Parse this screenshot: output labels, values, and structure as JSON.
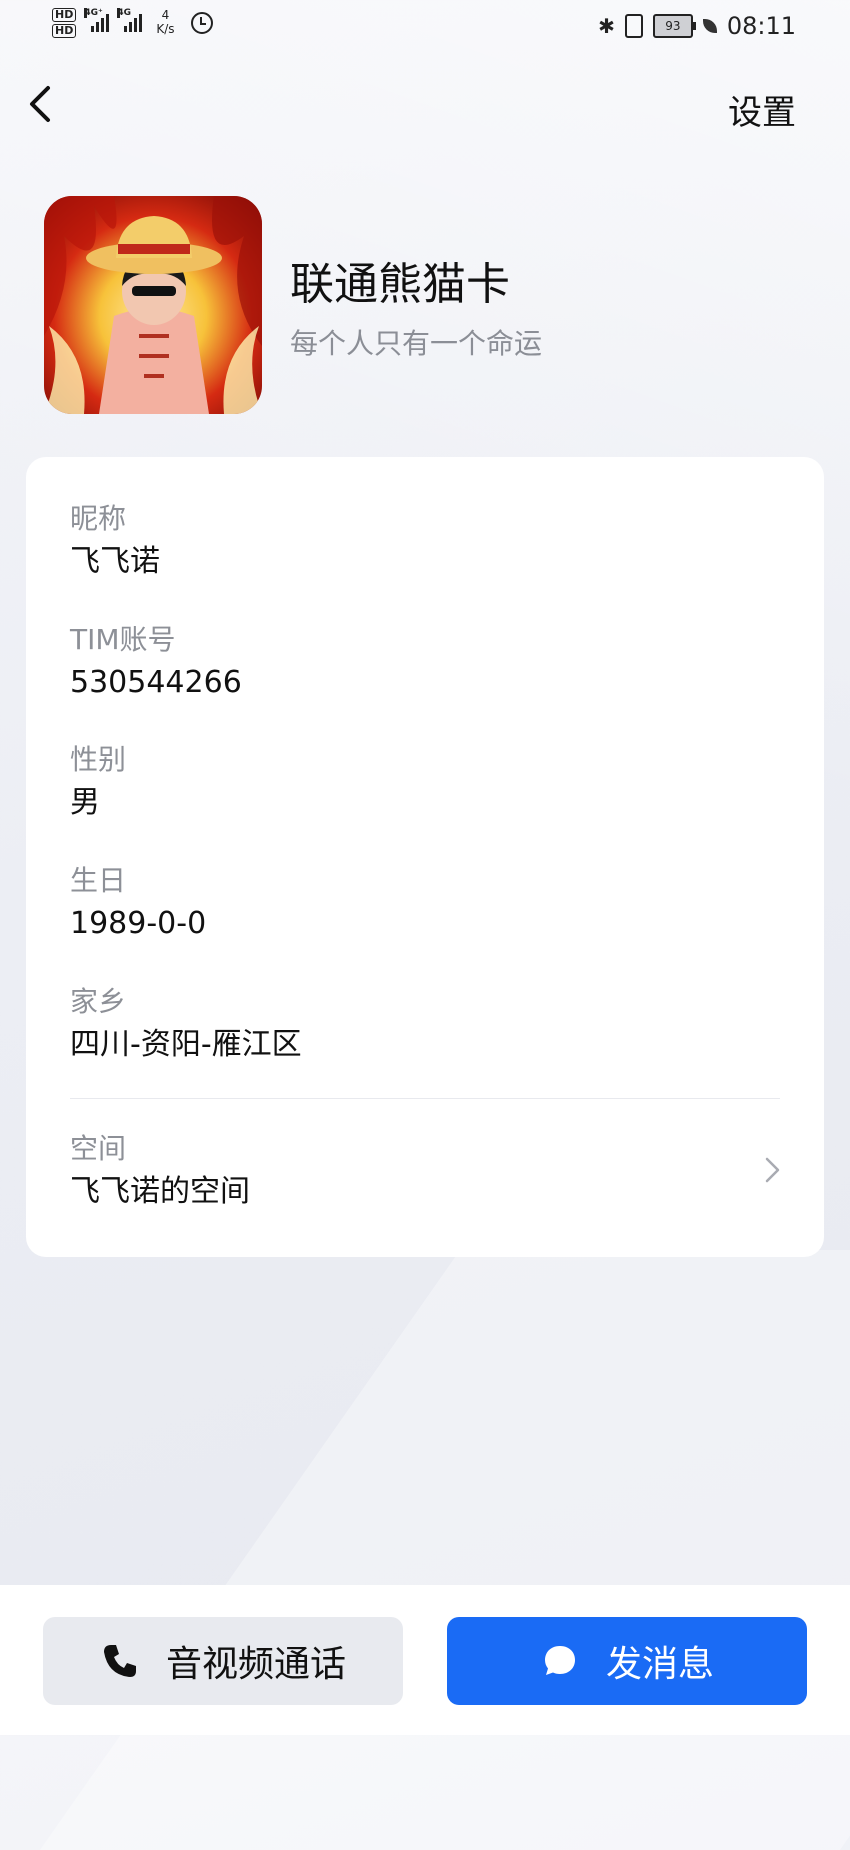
{
  "status_bar": {
    "hd_1": "HD",
    "hd_2": "HD",
    "sim1_network": "4G⁺",
    "sim2_network": "4G",
    "speed_value": "4",
    "speed_unit": "K/s",
    "battery": "93",
    "time": "08:11"
  },
  "header": {
    "back_icon": "chevron-left-icon",
    "settings_label": "设置"
  },
  "profile": {
    "nickname": "联通熊猫卡",
    "signature": "每个人只有一个命运"
  },
  "info": {
    "nickname_label": "昵称",
    "nickname_value": "飞飞诺",
    "account_label": "TIM账号",
    "account_value": "530544266",
    "gender_label": "性别",
    "gender_value": "男",
    "birthday_label": "生日",
    "birthday_value": "1989-0-0",
    "hometown_label": "家乡",
    "hometown_value": "四川-资阳-雁江区",
    "space_label": "空间",
    "space_value": "飞飞诺的空间"
  },
  "actions": {
    "call_label": "音视频通话",
    "message_label": "发消息"
  },
  "colors": {
    "primary": "#1a6bf5",
    "secondary_button": "#e8eaef",
    "muted_text": "#8d9097"
  }
}
